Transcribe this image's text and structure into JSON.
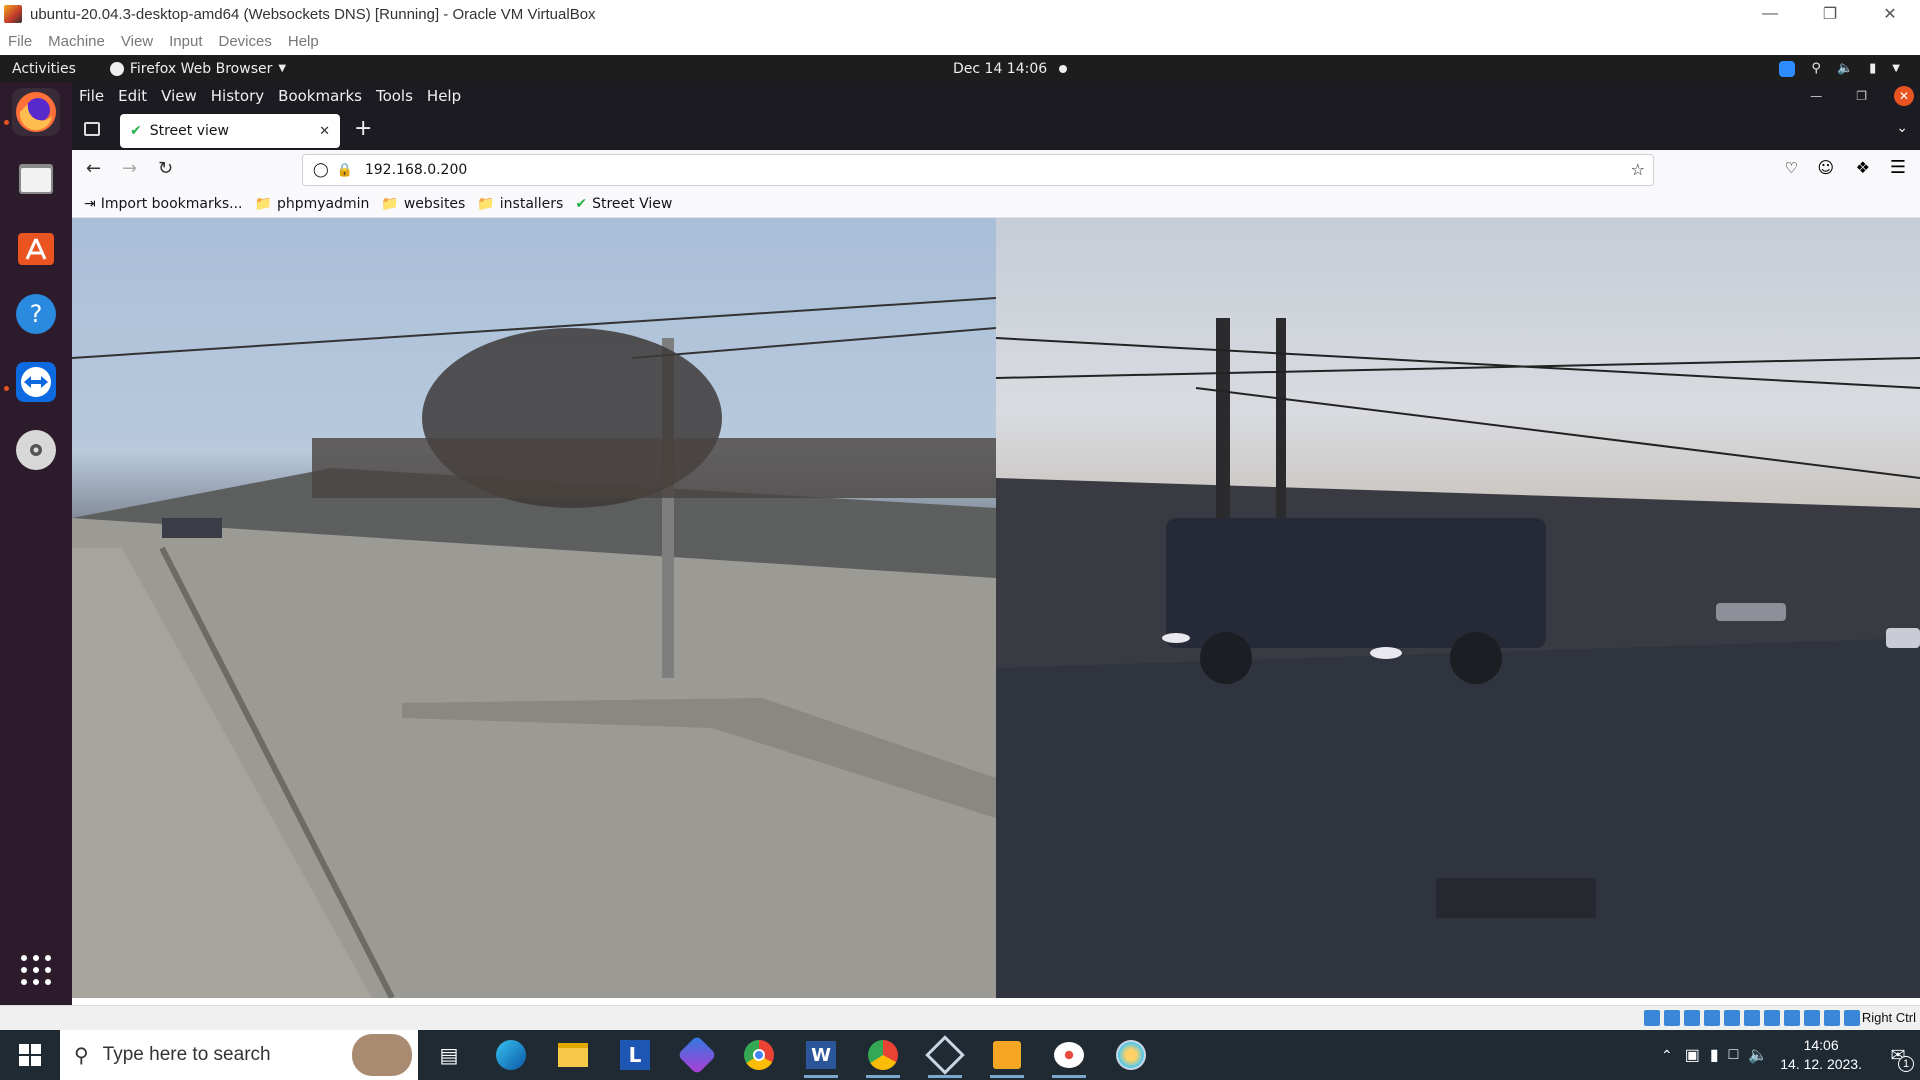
{
  "vbox": {
    "title": "ubuntu-20.04.3-desktop-amd64 (Websockets DNS) [Running] - Oracle VM VirtualBox",
    "menu": [
      "File",
      "Machine",
      "View",
      "Input",
      "Devices",
      "Help"
    ],
    "host_key": "Right Ctrl"
  },
  "gnome": {
    "activities": "Activities",
    "app_menu": "Firefox Web Browser",
    "clock": "Dec 14  14:06"
  },
  "dock": {
    "items": [
      "firefox-icon",
      "files-icon",
      "software-icon",
      "help-icon",
      "teamviewer-icon",
      "dvd-icon",
      "show-apps-icon"
    ]
  },
  "firefox": {
    "menu": [
      "File",
      "Edit",
      "View",
      "History",
      "Bookmarks",
      "Tools",
      "Help"
    ],
    "tab_title": "Street view",
    "url": "192.168.0.200",
    "bookmarks": [
      "Import bookmarks...",
      "phpmyadmin",
      "websites",
      "installers",
      "Street View"
    ]
  },
  "taskbar": {
    "search_placeholder": "Type here to search",
    "apps": [
      "task-view-icon",
      "edge-icon",
      "file-explorer-icon",
      "l-app-icon",
      "bing-icon",
      "chrome-icon",
      "word-icon",
      "chrome-profile-icon",
      "virtualbox-icon",
      "sublime-icon",
      "paint-icon",
      "paint-brush-icon"
    ],
    "time": "14:06",
    "date": "14. 12. 2023.",
    "notification_count": "1"
  }
}
